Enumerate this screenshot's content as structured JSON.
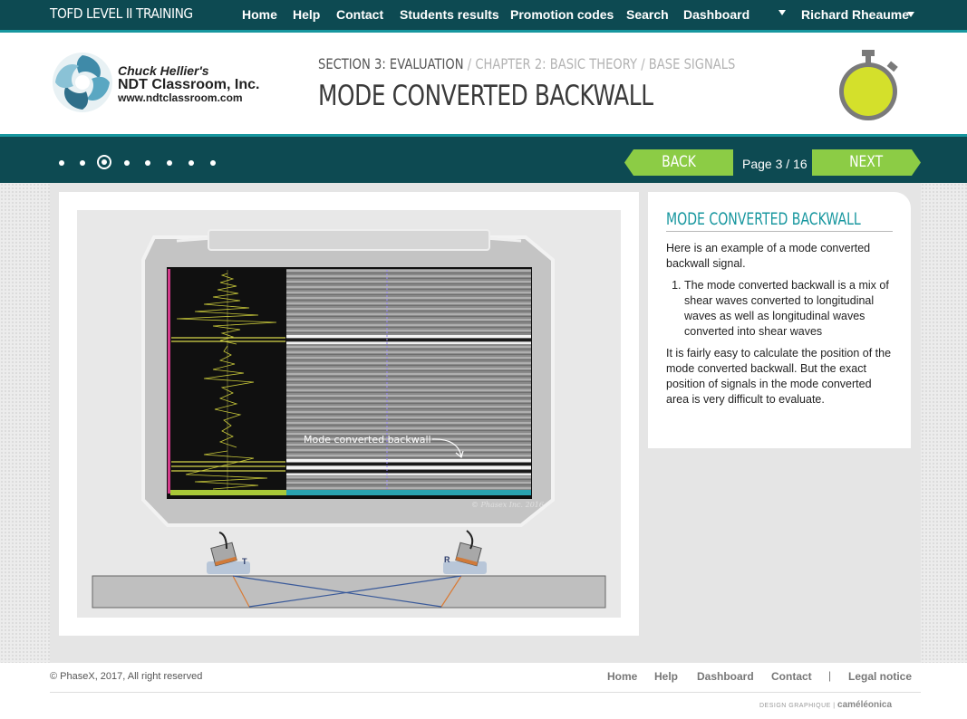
{
  "brand": "TOFD LEVEL II TRAINING",
  "nav": {
    "home": "Home",
    "help": "Help",
    "contact": "Contact",
    "students": "Students results",
    "promo": "Promotion codes",
    "search": "Search",
    "dashboard": "Dashboard",
    "user": "Richard Rheaume"
  },
  "logo": {
    "line1": "Chuck Hellier's",
    "line2": "NDT Classroom, Inc.",
    "line3": "www.ndtclassroom.com"
  },
  "breadcrumb": {
    "section": "SECTION 3: EVALUATION",
    "sep1": " / ",
    "chapter": "CHAPTER 2: BASIC THEORY",
    "sep2": " / ",
    "topic": "BASE SIGNALS"
  },
  "page_title": "MODE CONVERTED BACKWALL",
  "progress": {
    "back_label": "BACK",
    "next_label": "NEXT",
    "page_info": "Page 3 / 16",
    "dot_count": 8,
    "active_dot": 3
  },
  "figure": {
    "annotation": "Mode converted backwall",
    "watermark": "© Phasex Inc. 2016",
    "probe_t": "T",
    "probe_r": "R"
  },
  "panel": {
    "title": "MODE CONVERTED BACKWALL",
    "intro": "Here is an example of a mode converted backwall signal.",
    "list_item_1": "The mode converted backwall is a mix of shear waves converted to longitudinal waves as well as longitudinal waves converted into shear waves",
    "outro": "It is fairly easy to calculate the position of the mode converted backwall. But the exact position of signals in the mode converted area is very difficult to evaluate."
  },
  "footer": {
    "copyright": "© PhaseX, 2017, All right reserved",
    "home": "Home",
    "help": "Help",
    "dashboard": "Dashboard",
    "contact": "Contact",
    "separator": "|",
    "legal": "Legal notice",
    "credit_prefix": "DESIGN GRAPHIQUE |",
    "credit_brand": "caméléonica"
  },
  "colors": {
    "dark_teal": "#0d4a52",
    "teal_accent": "#18979f",
    "green_button": "#8ccc45",
    "timer_fill": "#d4e02b"
  },
  "icons": {
    "timer": "stopwatch-icon",
    "user_dropdown": "chevron-down-icon",
    "nav_dropdown": "chevron-down-icon"
  }
}
